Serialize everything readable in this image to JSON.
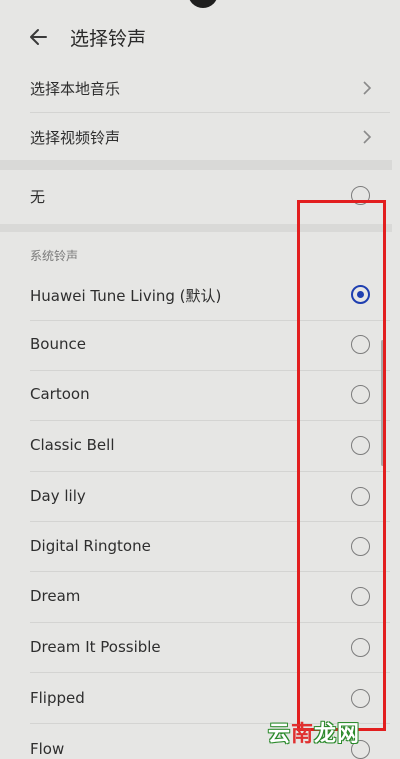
{
  "header": {
    "title": "选择铃声"
  },
  "top_rows": [
    {
      "label": "选择本地音乐"
    },
    {
      "label": "选择视频铃声"
    }
  ],
  "none_row": {
    "label": "无"
  },
  "section": {
    "label": "系统铃声"
  },
  "ringtones": [
    {
      "label": "Huawei Tune Living (默认)",
      "selected": true
    },
    {
      "label": "Bounce",
      "selected": false
    },
    {
      "label": "Cartoon",
      "selected": false
    },
    {
      "label": "Classic Bell",
      "selected": false
    },
    {
      "label": "Day lily",
      "selected": false
    },
    {
      "label": "Digital Ringtone",
      "selected": false
    },
    {
      "label": "Dream",
      "selected": false
    },
    {
      "label": "Dream It Possible",
      "selected": false
    },
    {
      "label": "Flipped",
      "selected": false
    },
    {
      "label": "Flow",
      "selected": false
    }
  ],
  "watermark": {
    "part1": "云",
    "part2": "南",
    "part3": "龙网"
  },
  "colors": {
    "accent": "#1f3fb0",
    "annotation": "#e21e1e",
    "background": "#e6e6e4"
  }
}
